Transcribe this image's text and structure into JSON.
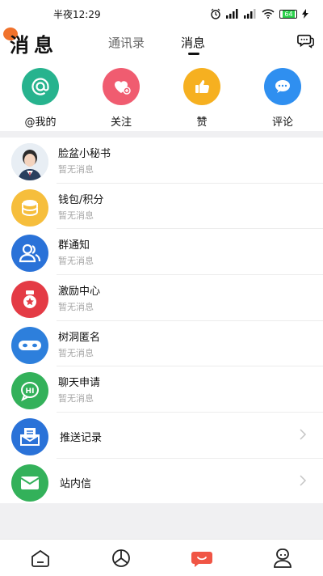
{
  "status_bar": {
    "time": "半夜12:29",
    "battery": "64"
  },
  "header": {
    "title": "消息",
    "tabs": [
      {
        "label": "通讯录",
        "active": false
      },
      {
        "label": "消息",
        "active": true
      }
    ]
  },
  "quick_actions": [
    {
      "label": "@我的",
      "icon": "at-icon",
      "color": "#27b38e"
    },
    {
      "label": "关注",
      "icon": "heart-plus-icon",
      "color": "#f05c70"
    },
    {
      "label": "赞",
      "icon": "thumbs-up-icon",
      "color": "#f6b020"
    },
    {
      "label": "评论",
      "icon": "comment-icon",
      "color": "#2f8ff0"
    }
  ],
  "messages": [
    {
      "name": "脸盆小秘书",
      "sub": "暂无消息",
      "icon": "assistant-avatar"
    },
    {
      "name": "钱包/积分",
      "sub": "暂无消息",
      "icon": "coins-icon",
      "color": "#f6be3c"
    },
    {
      "name": "群通知",
      "sub": "暂无消息",
      "icon": "group-icon",
      "color": "#2a72d8"
    },
    {
      "name": "激励中心",
      "sub": "暂无消息",
      "icon": "incentive-icon",
      "color": "#e43b45"
    },
    {
      "name": "树洞匿名",
      "sub": "暂无消息",
      "icon": "anonymous-mask-icon",
      "color": "#2d7fdc"
    },
    {
      "name": "聊天申请",
      "sub": "暂无消息",
      "icon": "chat-request-icon",
      "color": "#33b15a"
    }
  ],
  "other_items": [
    {
      "name": "推送记录",
      "icon": "push-record-icon",
      "color": "#2a72d8"
    },
    {
      "name": "站内信",
      "icon": "mail-icon",
      "color": "#33b15a"
    }
  ],
  "bottom_nav": [
    {
      "icon": "home-icon",
      "active": false
    },
    {
      "icon": "discover-icon",
      "active": false
    },
    {
      "icon": "message-icon",
      "active": true,
      "color": "#f05545"
    },
    {
      "icon": "profile-icon",
      "active": false
    }
  ]
}
